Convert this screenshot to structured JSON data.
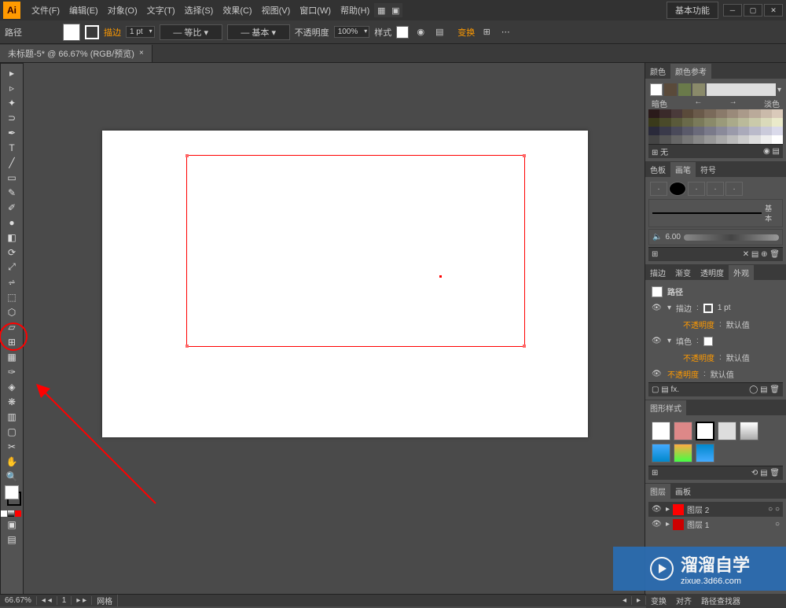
{
  "titlebar": {
    "logo": "Ai",
    "menus": {
      "file": "文件(F)",
      "edit": "编辑(E)",
      "object": "对象(O)",
      "type": "文字(T)",
      "select": "选择(S)",
      "effect": "效果(C)",
      "view": "视图(V)",
      "window": "窗口(W)",
      "help": "帮助(H)"
    },
    "basic_function": "基本功能"
  },
  "controlbar": {
    "selection": "路径",
    "stroke": "描边",
    "stroke_weight": "1 pt",
    "uniform": "等比",
    "basic": "基本",
    "opacity_label": "不透明度",
    "opacity_value": "100%",
    "style_label": "样式",
    "change": "变换"
  },
  "document": {
    "tab_title": "未标题-5* @ 66.67% (RGB/预览)"
  },
  "statusbar": {
    "zoom": "66.67%",
    "page": "1",
    "label": "网格"
  },
  "panels": {
    "color": {
      "tab1": "颜色",
      "tab2": "颜色参考",
      "darker": "暗色",
      "lighter": "淡色",
      "none_label": "无"
    },
    "brushes": {
      "tab1": "色板",
      "tab2": "画笔",
      "tab3": "符号",
      "basic": "基本",
      "size": "6.00"
    },
    "stroke_panel": {
      "tab1": "描边",
      "tab2": "渐变",
      "tab3": "透明度",
      "tab4": "外观",
      "path": "路径",
      "stroke": "描边",
      "stroke_val": "1 pt",
      "opacity": "不透明度",
      "default": "默认值",
      "fill": "填色"
    },
    "graphic_styles": {
      "tab": "图形样式"
    },
    "layers": {
      "tab1": "图层",
      "tab2": "画板",
      "layer2": "图层 2",
      "layer1": "图层 1"
    },
    "bottom": {
      "transform": "变换",
      "align": "对齐",
      "pathfinder": "路径查找器"
    }
  },
  "watermark": {
    "big": "溜溜自学",
    "small": "zixue.3d66.com"
  }
}
